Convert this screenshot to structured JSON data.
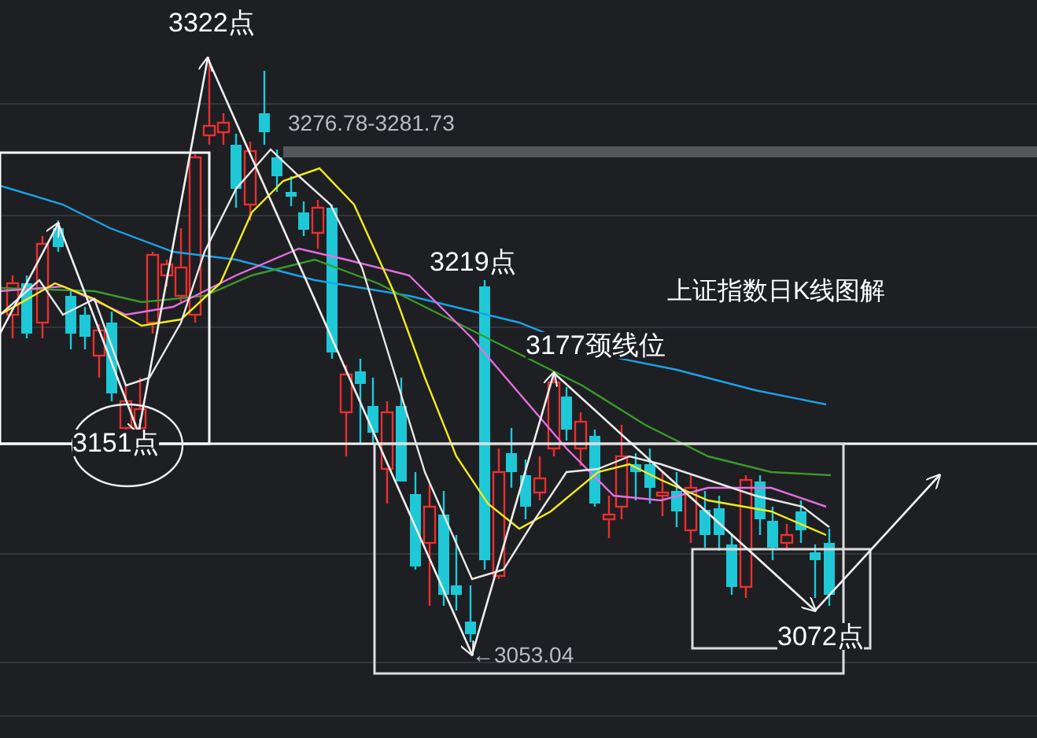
{
  "chart": {
    "title": "上证指数日K线图解",
    "labels": [
      {
        "kind": "point",
        "text": "3322点"
      },
      {
        "kind": "price",
        "text": "3276.78-3281.73"
      },
      {
        "kind": "point",
        "text": "3219点"
      },
      {
        "kind": "point",
        "text": "3177颈线位"
      },
      {
        "kind": "point",
        "text": "3151点"
      },
      {
        "kind": "price",
        "text": "←3053.04"
      },
      {
        "kind": "point",
        "text": "3072点"
      }
    ]
  }
}
